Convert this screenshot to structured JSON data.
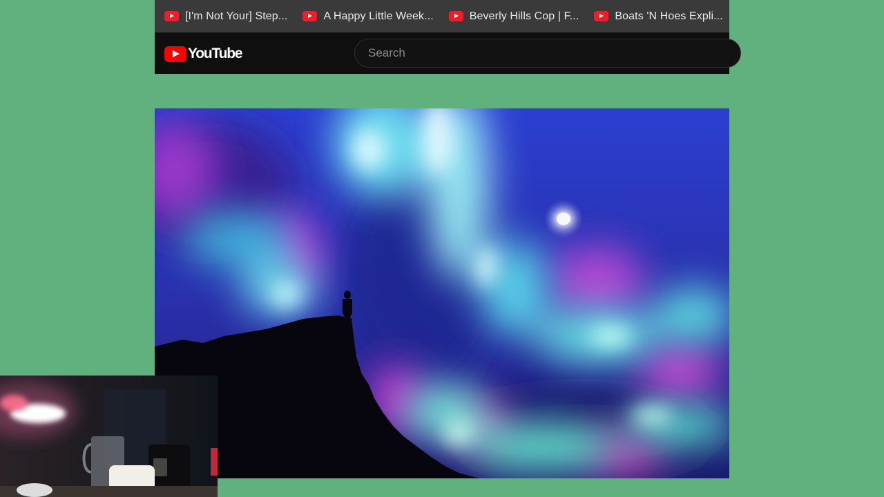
{
  "bookmarks": [
    {
      "label": "[I'm Not Your] Step...",
      "icon": "youtube-icon"
    },
    {
      "label": "A Happy Little Week...",
      "icon": "youtube-icon"
    },
    {
      "label": "Beverly Hills Cop | F...",
      "icon": "youtube-icon"
    },
    {
      "label": "Boats 'N Hoes Expli...",
      "icon": "youtube-icon"
    }
  ],
  "header": {
    "logo_text": "YouTube",
    "search_placeholder": "Search"
  },
  "colors": {
    "page_background": "#61b17f",
    "bookmark_bar": "#3a3a3a",
    "header_background": "#0f0f0f",
    "youtube_red": "#ff0000"
  }
}
